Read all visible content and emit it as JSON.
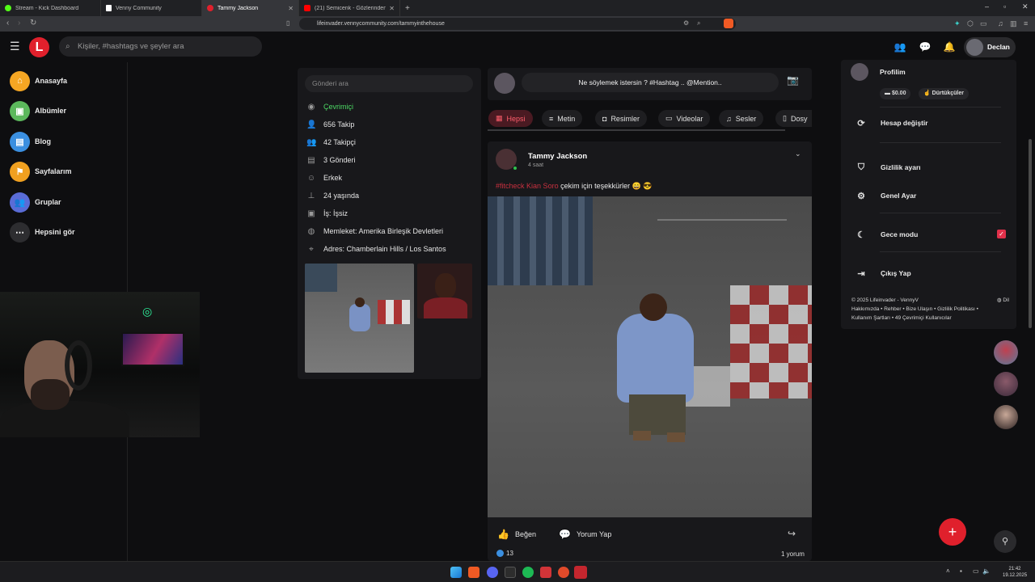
{
  "browser": {
    "tabs": [
      {
        "title": "Stream - Kick Dashboard",
        "color": "#53fc18"
      },
      {
        "title": "Venny Community",
        "color": "#ffffff"
      },
      {
        "title": "Tammy Jackson",
        "color": "#e0202c"
      },
      {
        "title": "(21) Semicenk - Gözlerinden Gözlerin",
        "color": "#ff0000"
      }
    ],
    "new_tab": "+",
    "url": "lifeinvader.vennycommunity.com/tammyinthehouse"
  },
  "header": {
    "logo": "L",
    "search_placeholder": "Kişiler, #hashtags ve şeyler ara",
    "user_name": "Declan"
  },
  "left_nav": [
    {
      "label": "Anasayfa",
      "color": "#f5a623",
      "icon": "home-icon"
    },
    {
      "label": "Albümler",
      "color": "#5cb85c",
      "icon": "photo-icon"
    },
    {
      "label": "Blog",
      "color": "#3b8fe0",
      "icon": "blog-icon"
    },
    {
      "label": "Sayfalarım",
      "color": "#f0a020",
      "icon": "flag-icon"
    },
    {
      "label": "Gruplar",
      "color": "#5a6cd6",
      "icon": "group-icon"
    },
    {
      "label": "Hepsini gör",
      "color": "#2d2d30",
      "icon": "more-icon"
    }
  ],
  "profile": {
    "search_placeholder": "Gönderi ara",
    "status": "Çevrimiçi",
    "status_color": "#4cd964",
    "follow": "656 Takip",
    "followers": "42 Takipçi",
    "posts": "3 Gönderi",
    "gender": "Erkek",
    "age": "24 yaşında",
    "job": "İş: İşsiz",
    "country": "Memleket: Amerika Birleşik Devletleri",
    "address": "Adres: Chamberlain Hills / Los Santos"
  },
  "composer": {
    "placeholder": "Ne söylemek istersin ? #Hashtag .. @Mention.."
  },
  "filters": [
    {
      "label": "Hepsi",
      "icon": "grid-icon"
    },
    {
      "label": "Metin",
      "icon": "text-icon"
    },
    {
      "label": "Resimler",
      "icon": "camera-icon"
    },
    {
      "label": "Videolar",
      "icon": "video-icon"
    },
    {
      "label": "Sesler",
      "icon": "music-icon"
    },
    {
      "label": "Dosy",
      "icon": "file-icon"
    }
  ],
  "post": {
    "author": "Tammy Jackson",
    "time": "4 saat",
    "hashtag": "#fitcheck",
    "mention": "Kian Soro",
    "text": "çekim için teşekkürler 😄 😎",
    "like": "Beğen",
    "comment": "Yorum Yap",
    "likes_count": "13",
    "comments_count": "1 yorum"
  },
  "dropdown": {
    "profile": "Profilim",
    "balance": "$0.00",
    "pokes": "Dürtükçüler",
    "switch": "Hesap değiştir",
    "privacy": "Gizlilik ayarı",
    "general": "Genel Ayar",
    "night": "Gece modu",
    "logout": "Çıkış Yap",
    "footer_line1": "© 2025 Lifeinvader - VennyV",
    "lang": "Dil",
    "footer_line2": "Hakkımızda • Rehber • Bize Ulaşın • Gizlilik Politikası •",
    "footer_line3": "Kullanım Şartları • 49 Çevrimiçi Kullanıcılar"
  },
  "taskbar": {
    "time": "21:42",
    "date": "19.12.2025"
  }
}
